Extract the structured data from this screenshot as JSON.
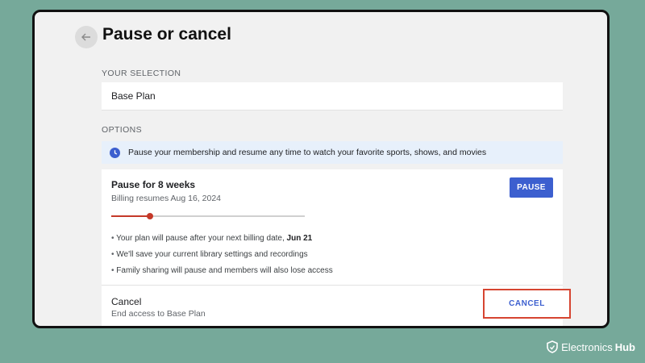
{
  "header": {
    "title": "Pause or cancel",
    "back_icon": "arrow-left-icon"
  },
  "selection": {
    "label": "YOUR SELECTION",
    "plan": "Base Plan"
  },
  "options": {
    "label": "OPTIONS",
    "banner": {
      "icon": "clock-icon",
      "text": "Pause your membership and resume any time to watch your favorite sports, shows, and movies"
    },
    "pause": {
      "title": "Pause for 8 weeks",
      "subtitle": "Billing resumes Aug 16, 2024",
      "button": "PAUSE",
      "slider_fraction": 0.2,
      "bullets": {
        "b1_text": "Your plan will pause after your next billing date, ",
        "b1_bold": "Jun 21",
        "b2": "We'll save your current library settings and recordings",
        "b3": "Family sharing will pause and members will also lose access"
      }
    },
    "cancel": {
      "title": "Cancel",
      "subtitle": "End access to Base Plan",
      "button": "CANCEL"
    }
  },
  "watermark": {
    "brand": "Electronics",
    "brand_bold": "Hub"
  },
  "colors": {
    "accent": "#3c5fcf",
    "slider": "#c53929",
    "highlight": "#d64531",
    "banner_bg": "#e7f0fb"
  }
}
